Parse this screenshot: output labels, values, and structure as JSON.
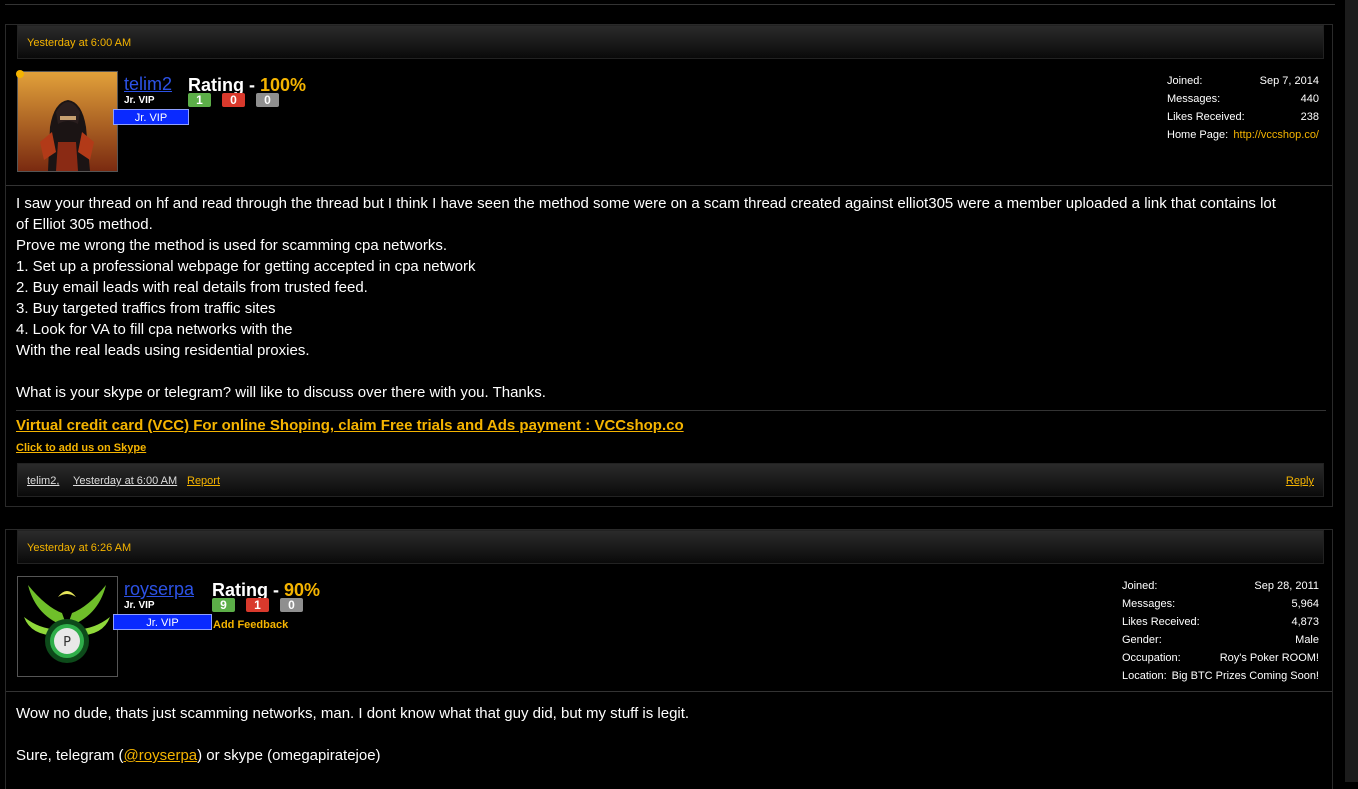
{
  "colors": {
    "accent": "#f5b400",
    "username": "#2c52e6",
    "banner": "#0a2aff",
    "positive": "#5cae48",
    "negative": "#d9392c",
    "neutral": "#8f8f8f"
  },
  "posts": [
    {
      "timestamp": "Yesterday at 6:00 AM",
      "user": {
        "name": "telim2",
        "title": "Jr. VIP",
        "banner": "Jr. VIP",
        "rating_label": "Rating - ",
        "rating_pct": "100%",
        "feedback": {
          "positive": "1",
          "negative": "0",
          "neutral": "0"
        },
        "info": [
          {
            "label": "Joined:",
            "value": "Sep 7, 2014"
          },
          {
            "label": "Messages:",
            "value": "440"
          },
          {
            "label": "Likes Received:",
            "value": "238"
          },
          {
            "label": "Home Page:",
            "value": "http://vccshop.co/"
          }
        ]
      },
      "message": [
        "I saw your thread on hf and read through the thread but I think I have seen the method some were on a scam thread created against elliot305 were a member uploaded a link that contains lot",
        "of Elliot 305 method.",
        "Prove me wrong the method is used for scamming cpa networks.",
        "1. Set up a professional webpage for getting accepted in cpa network",
        "2. Buy email leads with real details from trusted feed.",
        "3. Buy targeted traffics from traffic sites",
        "4. Look for VA to fill cpa networks with the",
        "With the real leads using residential proxies.",
        "",
        "What is your skype or telegram? will like to discuss over there with you. Thanks."
      ],
      "signature": {
        "main": "Virtual credit card (VCC) For online Shoping, claim Free trials and Ads payment : VCCshop.co",
        "sub": "Click to add us on Skype"
      },
      "footer": {
        "author": "telim2,",
        "time": "Yesterday at 6:00 AM",
        "report": "Report",
        "reply": "Reply"
      }
    },
    {
      "timestamp": "Yesterday at 6:26 AM",
      "user": {
        "name": "royserpa",
        "title": "Jr. VIP",
        "banner": "Jr. VIP",
        "avatar_letter": "P",
        "rating_label": "Rating - ",
        "rating_pct": "90%",
        "feedback": {
          "positive": "9",
          "negative": "1",
          "neutral": "0"
        },
        "add_feedback": "Add Feedback",
        "info": [
          {
            "label": "Joined:",
            "value": "Sep 28, 2011"
          },
          {
            "label": "Messages:",
            "value": "5,964"
          },
          {
            "label": "Likes Received:",
            "value": "4,873"
          },
          {
            "label": "Gender:",
            "value": "Male"
          },
          {
            "label": "Occupation:",
            "value": "Roy's Poker ROOM!"
          },
          {
            "label": "Location:",
            "value": "Big BTC Prizes Coming Soon!"
          }
        ]
      },
      "message_line1": "Wow no dude, thats just scamming networks, man. I dont know what that guy did, but my stuff is legit.",
      "message_line2_pre": "Sure, telegram (",
      "message_line2_mention": "@royserpa",
      "message_line2_post": ") or skype (omegapiratejoe)"
    }
  ]
}
